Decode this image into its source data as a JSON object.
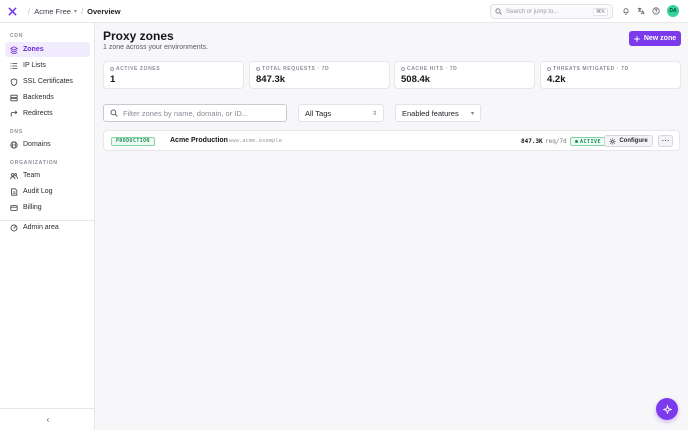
{
  "colors": {
    "accent": "#7c3aed",
    "success": "#1f8a52",
    "avatar": "#34d399"
  },
  "header": {
    "logo_icon": "brand-x-icon",
    "org": "Acme Free",
    "page": "Overview",
    "search_placeholder": "Search or jump to...",
    "search_shortcut": "⌘K",
    "avatar_initials": "DA",
    "icons": [
      "bell-icon",
      "translate-icon",
      "help-icon"
    ]
  },
  "sidebar": {
    "sections": {
      "cdn": "CDN",
      "dns": "DNS",
      "organization": "ORGANIZATION"
    },
    "cdn_items": [
      {
        "label": "Zones",
        "icon": "zones-icon",
        "active": true
      },
      {
        "label": "IP Lists",
        "icon": "list-icon"
      },
      {
        "label": "SSL Certificates",
        "icon": "shield-icon"
      },
      {
        "label": "Backends",
        "icon": "server-icon"
      },
      {
        "label": "Redirects",
        "icon": "redirect-icon"
      }
    ],
    "dns_items": [
      {
        "label": "Domains",
        "icon": "globe-icon"
      }
    ],
    "org_items": [
      {
        "label": "Team",
        "icon": "users-icon"
      },
      {
        "label": "Audit Log",
        "icon": "document-icon"
      },
      {
        "label": "Billing",
        "icon": "card-icon"
      }
    ],
    "admin": {
      "label": "Admin area",
      "icon": "admin-icon"
    },
    "collapse_icon": "chevron-left-icon"
  },
  "main": {
    "title": "Proxy zones",
    "subtitle": "1 zone across your environments.",
    "new_button": "New zone",
    "stats": [
      {
        "label": "ACTIVE ZONES",
        "value": "1"
      },
      {
        "label": "TOTAL REQUESTS · 7D",
        "value": "847.3k"
      },
      {
        "label": "CACHE HITS · 7D",
        "value": "508.4k"
      },
      {
        "label": "THREATS MITIGATED · 7D",
        "value": "4.2k"
      }
    ],
    "filter_placeholder": "Filter zones by name, domain, or ID...",
    "tags_select": "All Tags",
    "features_select": "Enabled features",
    "zones": [
      {
        "env": "PRODUCTION",
        "name": "Acme Production",
        "host": "www.acme.example",
        "requests": "847.3K",
        "requests_unit": "req/7d",
        "status": "ACTIVE",
        "configure": "Configure",
        "more": "⋯"
      }
    ]
  },
  "fab_icon": "sparkle-icon"
}
